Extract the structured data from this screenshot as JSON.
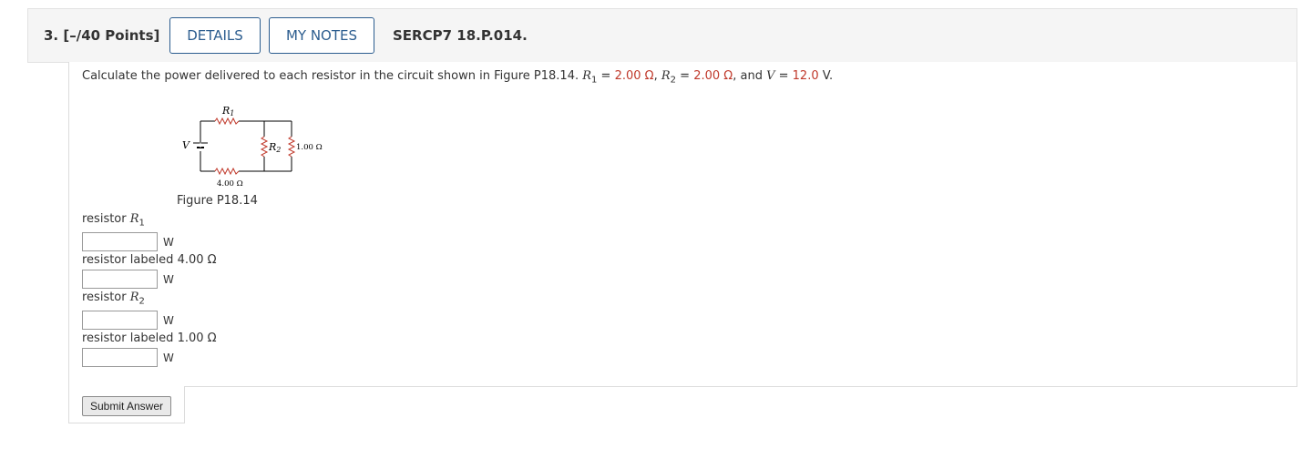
{
  "header": {
    "question_number": "3. [–/40 Points]",
    "details_label": "DETAILS",
    "notes_label": "MY NOTES",
    "problem_code": "SERCP7 18.P.014."
  },
  "prompt": {
    "text_before": "Calculate the power delivered to each resistor in the circuit shown in Figure P18.14. ",
    "r1_symbol": "R",
    "r1_sub": "1",
    "eq1": " = ",
    "r1_value": "2.00 Ω",
    "sep1": ", ",
    "r2_symbol": "R",
    "r2_sub": "2",
    "eq2": " = ",
    "r2_value": "2.00 Ω",
    "sep2": ", and ",
    "v_symbol": "V",
    "eq3": " = ",
    "v_value": "12.0",
    "v_unit": " V."
  },
  "figure": {
    "caption": "Figure P18.14",
    "label_r1": "R",
    "label_r1_sub": "1",
    "label_r2": "R",
    "label_r2_sub": "2",
    "label_v": "V",
    "label_bottom": "4.00 Ω",
    "label_right": "1.00 Ω"
  },
  "fields": [
    {
      "label_text": "resistor ",
      "label_symbol": "R",
      "label_sub": "1",
      "value": "",
      "unit": "W"
    },
    {
      "label_text": "resistor labeled 4.00 Ω",
      "value": "",
      "unit": "W"
    },
    {
      "label_text": "resistor ",
      "label_symbol": "R",
      "label_sub": "2",
      "value": "",
      "unit": "W"
    },
    {
      "label_text": "resistor labeled 1.00 Ω",
      "value": "",
      "unit": "W"
    }
  ],
  "submit_label": "Submit Answer",
  "colors": {
    "accent": "#2c5d8f",
    "given_value": "#c0392b"
  }
}
